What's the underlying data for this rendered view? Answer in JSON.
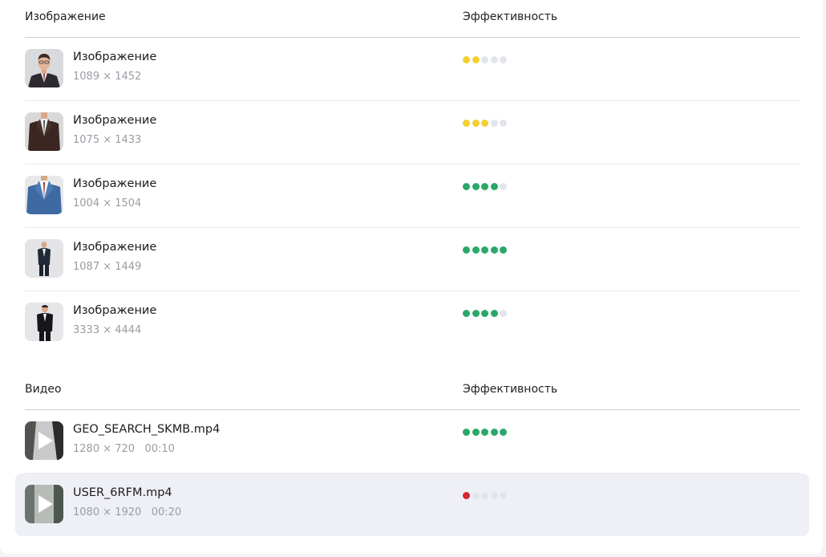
{
  "images": {
    "header_left": "Изображение",
    "header_right": "Эффективность",
    "items": [
      {
        "title": "Изображение",
        "meta": "1089 × 1452",
        "rating": 2,
        "color": "#f3cf2f",
        "thumb": "portrait-man-glasses"
      },
      {
        "title": "Изображение",
        "meta": "1075 × 1433",
        "rating": 3,
        "color": "#f3cf2f",
        "thumb": "man-dark-suit-torso"
      },
      {
        "title": "Изображение",
        "meta": "1004 × 1504",
        "rating": 4,
        "color": "#2aa869",
        "thumb": "man-blue-suit-torso"
      },
      {
        "title": "Изображение",
        "meta": "1087 × 1449",
        "rating": 5,
        "color": "#2aa869",
        "thumb": "man-black-suit-full"
      },
      {
        "title": "Изображение",
        "meta": "3333 × 4444",
        "rating": 4,
        "color": "#2aa869",
        "thumb": "man-black-suit-standing"
      }
    ]
  },
  "videos": {
    "header_left": "Видео",
    "header_right": "Эффективность",
    "items": [
      {
        "title": "GEO_SEARCH_SKMB.mp4",
        "meta": "1280 × 720   00:10",
        "rating": 5,
        "color": "#2aa869",
        "thumb": "play-icon"
      },
      {
        "title": "USER_6RFM.mp4",
        "meta": "1080 × 1920   00:20",
        "rating": 1,
        "color": "#d7262d",
        "thumb": "play-icon"
      }
    ]
  },
  "rating_max": 5
}
